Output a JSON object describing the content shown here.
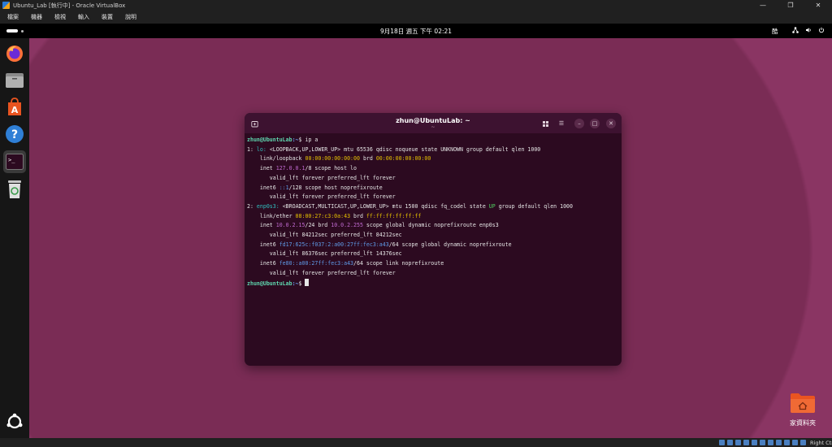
{
  "vbox": {
    "title": "Ubuntu_Lab [執行中] - Oracle VirtualBox",
    "menu": [
      "檔案",
      "機器",
      "檢視",
      "輸入",
      "裝置",
      "說明"
    ],
    "host_key": "Right Ctrl"
  },
  "topbar": {
    "clock": "9月18日 週五 下午 02:21",
    "ime": "酷"
  },
  "dock": {
    "items": [
      {
        "icon": "firefox-icon"
      },
      {
        "icon": "files-icon"
      },
      {
        "icon": "app-center-icon"
      },
      {
        "icon": "help-icon"
      },
      {
        "icon": "terminal-icon"
      },
      {
        "icon": "trash-icon"
      },
      {
        "icon": "show-apps-icon"
      }
    ]
  },
  "terminal": {
    "title": "zhun@UbuntuLab: ~",
    "subtitle": "~",
    "lines": {
      "l1_prompt": "zhun@UbuntuLab",
      "l1_path": ":~",
      "l1_cmd": "$ ip a",
      "l2_num": "1: ",
      "l2_iface": "lo:",
      "l2_rest": " <LOOPBACK,UP,LOWER_UP> mtu 65536 qdisc noqueue state UNKNOWN group default qlen 1000",
      "l3_a": "    link/loopback ",
      "l3_mac1": "00:00:00:00:00:00",
      "l3_b": " brd ",
      "l3_mac2": "00:00:00:00:00:00",
      "l4_a": "    inet ",
      "l4_ip": "127.0.0.1",
      "l4_b": "/8 scope host lo",
      "l5": "       valid_lft forever preferred_lft forever",
      "l6_a": "    inet6 ",
      "l6_ip": "::1",
      "l6_b": "/128 scope host noprefixroute",
      "l7": "       valid_lft forever preferred_lft forever",
      "l8_num": "2: ",
      "l8_iface": "enp0s3:",
      "l8_a": " <BROADCAST,MULTICAST,UP,LOWER_UP> mtu 1500 qdisc fq_codel state ",
      "l8_up": "UP",
      "l8_b": " group default qlen 1000",
      "l9_a": "    link/ether ",
      "l9_mac1": "08:00:27:c3:0a:43",
      "l9_b": " brd ",
      "l9_mac2": "ff:ff:ff:ff:ff:ff",
      "l10_a": "    inet ",
      "l10_ip": "10.0.2.15",
      "l10_b": "/24 brd ",
      "l10_brd": "10.0.2.255",
      "l10_c": " scope global dynamic noprefixroute enp0s3",
      "l11": "       valid_lft 84212sec preferred_lft 84212sec",
      "l12_a": "    inet6 ",
      "l12_ip": "fd17:625c:f037:2:a00:27ff:fec3:a43",
      "l12_b": "/64 scope global dynamic noprefixroute",
      "l13": "       valid_lft 86376sec preferred_lft 14376sec",
      "l14_a": "    inet6 ",
      "l14_ip": "fe80::a00:27ff:fec3:a43",
      "l14_b": "/64 scope link noprefixroute",
      "l15": "       valid_lft forever preferred_lft forever",
      "l16_prompt": "zhun@UbuntuLab",
      "l16_path": ":~",
      "l16_cmd": "$ "
    }
  },
  "desktop": {
    "home_label": "家資料夾"
  },
  "colors": {
    "terminal_bg": "#2c0a20",
    "accent": "#e95420"
  }
}
